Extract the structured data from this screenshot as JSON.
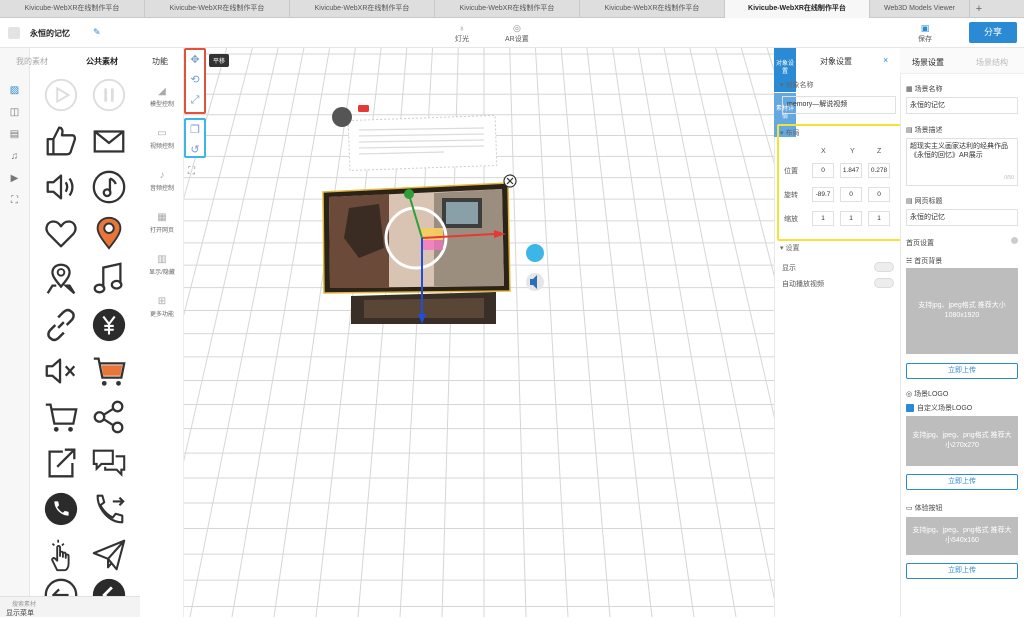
{
  "browser": {
    "tabs": [
      {
        "label": "Kivicube-WebXR在线制作平台"
      },
      {
        "label": "Kivicube-WebXR在线制作平台"
      },
      {
        "label": "Kivicube-WebXR在线制作平台"
      },
      {
        "label": "Kivicube-WebXR在线制作平台"
      },
      {
        "label": "Kivicube-WebXR在线制作平台"
      },
      {
        "label": "Kivicube-WebXR在线制作平台"
      },
      {
        "label": "Web3D Models Viewer"
      }
    ],
    "add": "+"
  },
  "topbar": {
    "project_title": "永恒的记忆",
    "light_label": "灯光",
    "ar_label": "AR设置",
    "save_label": "保存",
    "share_label": "分享"
  },
  "materials": {
    "tab_mine": "我的素材",
    "tab_public": "公共素材",
    "search_placeholder": "搜索素材",
    "menu_label": "显示菜单",
    "icons": [
      "play-circle",
      "pause-circle",
      "thumbs-up",
      "mail",
      "speaker",
      "music-circle",
      "heart",
      "location-pin",
      "map-pin",
      "music-note",
      "link",
      "yen-circle",
      "mute",
      "cart-orange",
      "cart",
      "share-nodes",
      "share-box",
      "chat-bubbles",
      "phone-circle",
      "phone-forward",
      "hand-tap",
      "paper-plane",
      "arrow-left-circle",
      "chevron-left-circle"
    ]
  },
  "functions": {
    "title": "功能",
    "items": [
      "模型控制",
      "视频控制",
      "音频控制",
      "打开网页",
      "显示/隐藏",
      "更多功能"
    ]
  },
  "canvas": {
    "tooltip": "平移"
  },
  "object_panel": {
    "tab_object": "对象设置",
    "vtab_object": "对象设置",
    "vtab_material": "素材详情",
    "close": "×",
    "name_section": "对象名称",
    "name_value": "memory—解说视频",
    "layout_section": "布局",
    "axes": [
      "X",
      "Y",
      "Z"
    ],
    "rows": [
      {
        "label": "位置",
        "values": [
          "0",
          "1.847",
          "0.278"
        ]
      },
      {
        "label": "旋转",
        "values": [
          "-89.7",
          "0",
          "0"
        ]
      },
      {
        "label": "缩放",
        "values": [
          "1",
          "1",
          "1"
        ]
      }
    ],
    "settings_section": "设置",
    "show_label": "显示",
    "autoplay_label": "自动播放视频"
  },
  "scene_panel": {
    "tab_settings": "场景设置",
    "tab_structure": "场景结构",
    "name_label": "场景名称",
    "name_value": "永恒的记忆",
    "desc_label": "场景描述",
    "desc_value": "超现实主义画家达利的经典作品《永恒的回忆》AR展示",
    "desc_count": "0/50",
    "webtitle_label": "网页标题",
    "webtitle_value": "永恒的记忆",
    "home_label": "首页设置",
    "home_bg_label": "首页背景",
    "home_bg_hint": "支持jpg、jpeg格式 推荐大小1080x1920",
    "upload_label": "立即上传",
    "logo_label": "场景LOGO",
    "custom_logo_label": "自定义场景LOGO",
    "logo_hint": "支持jpg、jpeg、png格式 推荐大小270x270",
    "experience_label": "体验按钮",
    "experience_hint": "支持jpg、jpeg、png格式 推荐大小540x160"
  },
  "colors": {
    "accent": "#2a8ad4",
    "highlight_red": "#e0523b",
    "highlight_blue": "#3cb6e6",
    "highlight_yellow": "#f2e23a"
  }
}
